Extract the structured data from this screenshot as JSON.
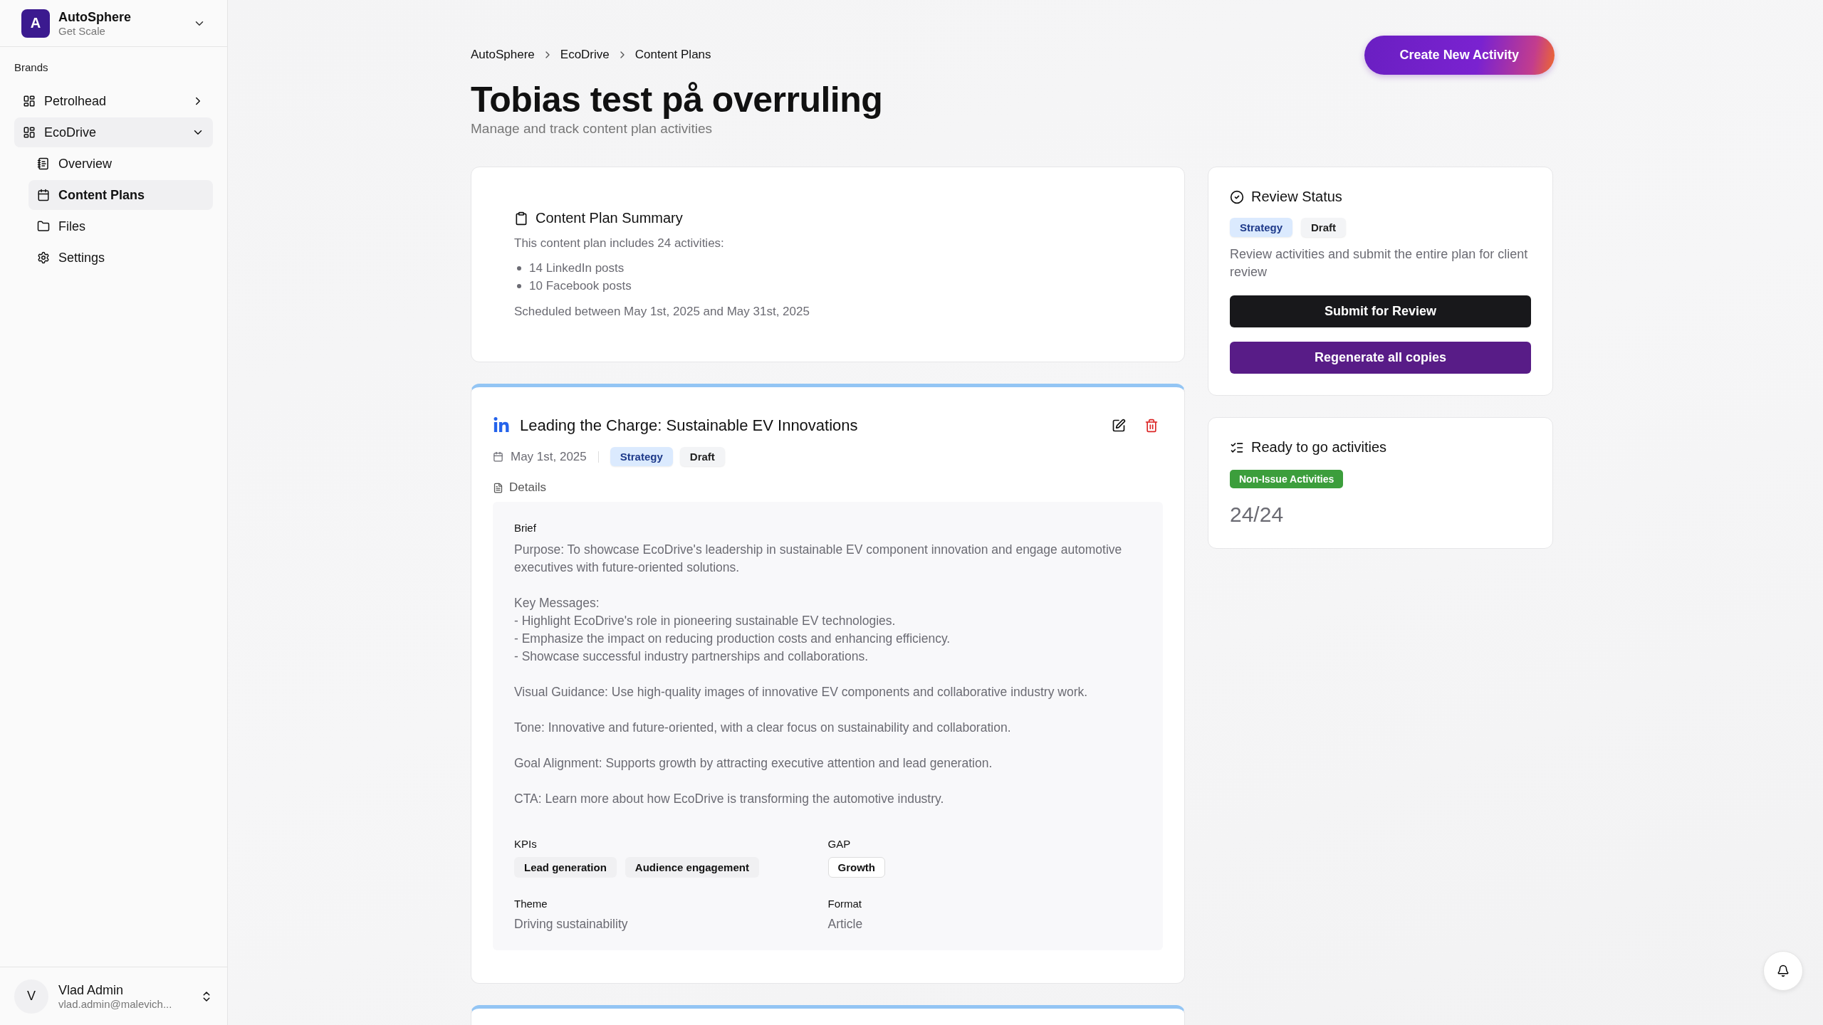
{
  "sidebar": {
    "org": {
      "initial": "A",
      "name": "AutoSphere",
      "plan": "Get Scale"
    },
    "section_label": "Brands",
    "brands": [
      {
        "label": "Petrolhead",
        "expanded": false
      },
      {
        "label": "EcoDrive",
        "expanded": true,
        "children": [
          {
            "label": "Overview",
            "selected": false
          },
          {
            "label": "Content Plans",
            "selected": true
          },
          {
            "label": "Files",
            "selected": false
          },
          {
            "label": "Settings",
            "selected": false
          }
        ]
      }
    ],
    "user": {
      "initial": "V",
      "name": "Vlad Admin",
      "email": "vlad.admin@malevich..."
    }
  },
  "breadcrumb": [
    "AutoSphere",
    "EcoDrive",
    "Content Plans"
  ],
  "create_button": "Create New Activity",
  "title": "Tobias test på overruling",
  "subtitle": "Manage and track content plan activities",
  "summary": {
    "title": "Content Plan Summary",
    "intro": "This content plan includes 24 activities:",
    "items": [
      "14 LinkedIn posts",
      "10 Facebook posts"
    ],
    "schedule": "Scheduled between May 1st, 2025 and May 31st, 2025"
  },
  "activities": [
    {
      "kind": "linkedin",
      "title": "Leading the Charge: Sustainable EV Innovations",
      "date": "May 1st, 2025",
      "tags": [
        {
          "label": "Strategy",
          "kind": "phase"
        },
        {
          "label": "Draft",
          "kind": "status"
        }
      ],
      "details_label": "Details",
      "brief_label": "Brief",
      "brief": "Purpose: To showcase EcoDrive's leadership in sustainable EV component innovation and engage automotive executives with future-oriented solutions.\n\nKey Messages:\n- Highlight EcoDrive's role in pioneering sustainable EV technologies.\n- Emphasize the impact on reducing production costs and enhancing efficiency.\n- Showcase successful industry partnerships and collaborations.\n\nVisual Guidance: Use high-quality images of innovative EV components and collaborative industry work.\n\nTone: Innovative and future-oriented, with a clear focus on sustainability and collaboration.\n\nGoal Alignment: Supports growth by attracting executive attention and lead generation.\n\nCTA: Learn more about how EcoDrive is transforming the automotive industry.",
      "kpis_label": "KPIs",
      "kpis": [
        "Lead generation",
        "Audience engagement"
      ],
      "gap_label": "GAP",
      "gap": [
        "Growth"
      ],
      "theme_label": "Theme",
      "theme": "Driving sustainability",
      "format_label": "Format",
      "format": "Article"
    }
  ],
  "review": {
    "title": "Review Status",
    "tags": [
      {
        "label": "Strategy",
        "kind": "phase"
      },
      {
        "label": "Draft",
        "kind": "status"
      }
    ],
    "description": "Review activities and submit the entire plan for client review",
    "submit_button": "Submit for Review",
    "regenerate_button": "Regenerate all copies"
  },
  "ready": {
    "title": "Ready to go activities",
    "badge": "Non-Issue Activities",
    "count": "24/24"
  }
}
